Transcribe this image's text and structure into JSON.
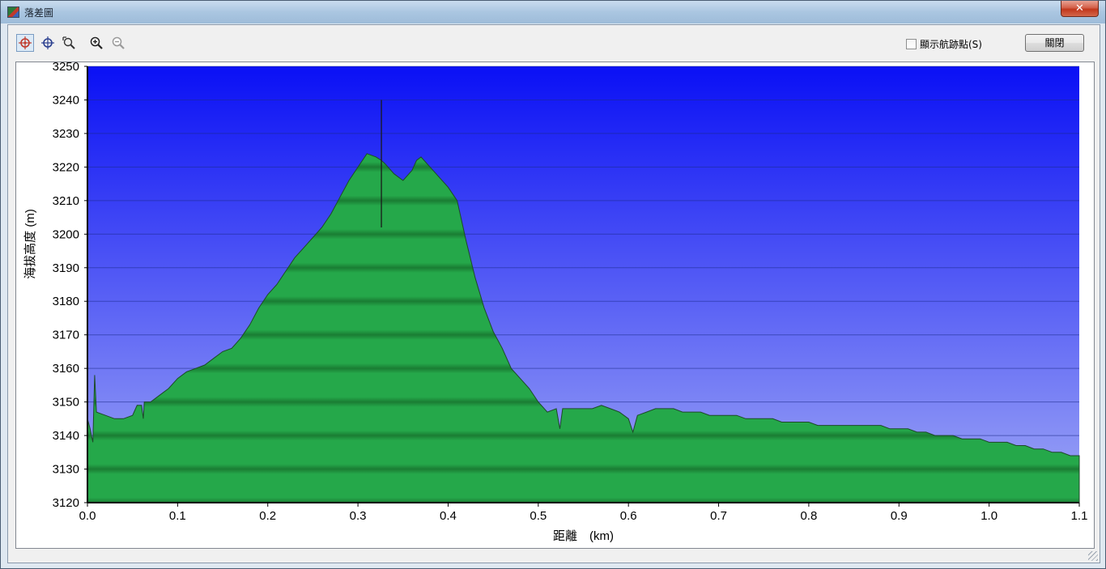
{
  "window": {
    "title": "落差圖",
    "close_glyph": "✕"
  },
  "toolbar": {
    "tools": [
      {
        "icon": "crosshair-select-icon",
        "active": true
      },
      {
        "icon": "crosshair-icon",
        "active": false
      },
      {
        "icon": "zoom-area-icon",
        "active": false
      },
      {
        "icon": "zoom-in-icon",
        "active": false
      },
      {
        "icon": "zoom-out-icon",
        "active": false
      }
    ],
    "show_waypoints_label": "顯示航跡點(S)",
    "show_waypoints_checked": false,
    "close_button_label": "關閉"
  },
  "colors": {
    "sky_top": "#0a10f5",
    "sky_bottom": "#9ea7f5",
    "terrain_light": "#25a84a",
    "terrain_dark": "#1a7d33",
    "terrain_outline": "#1d4a28",
    "axis": "#000000"
  },
  "chart_data": {
    "type": "area",
    "xlabel": "距離　(km)",
    "ylabel": "海拔高度 (m)",
    "xlim": [
      0.0,
      1.1
    ],
    "ylim": [
      3120,
      3250
    ],
    "xticks": [
      "0.0",
      "0.1",
      "0.2",
      "0.3",
      "0.4",
      "0.5",
      "0.6",
      "0.7",
      "0.8",
      "0.9",
      "1.0",
      "1.1"
    ],
    "yticks": [
      "3120",
      "3130",
      "3140",
      "3150",
      "3160",
      "3170",
      "3180",
      "3190",
      "3200",
      "3210",
      "3220",
      "3230",
      "3240",
      "3250"
    ],
    "grid": true,
    "cursor_x": 0.326,
    "series": [
      {
        "x": [
          0.0,
          0.003,
          0.006,
          0.008,
          0.01,
          0.02,
          0.03,
          0.04,
          0.05,
          0.055,
          0.06,
          0.062,
          0.063,
          0.07,
          0.08,
          0.09,
          0.1,
          0.11,
          0.12,
          0.13,
          0.14,
          0.15,
          0.16,
          0.17,
          0.18,
          0.19,
          0.2,
          0.21,
          0.22,
          0.23,
          0.24,
          0.25,
          0.26,
          0.27,
          0.28,
          0.29,
          0.3,
          0.31,
          0.32,
          0.326,
          0.33,
          0.34,
          0.35,
          0.36,
          0.365,
          0.37,
          0.38,
          0.39,
          0.4,
          0.41,
          0.42,
          0.43,
          0.44,
          0.45,
          0.46,
          0.47,
          0.48,
          0.49,
          0.5,
          0.51,
          0.52,
          0.524,
          0.527,
          0.53,
          0.54,
          0.55,
          0.56,
          0.57,
          0.58,
          0.59,
          0.6,
          0.605,
          0.61,
          0.62,
          0.63,
          0.64,
          0.65,
          0.66,
          0.67,
          0.68,
          0.69,
          0.7,
          0.71,
          0.72,
          0.73,
          0.74,
          0.75,
          0.76,
          0.77,
          0.78,
          0.79,
          0.8,
          0.81,
          0.82,
          0.83,
          0.84,
          0.85,
          0.86,
          0.87,
          0.88,
          0.89,
          0.9,
          0.91,
          0.92,
          0.93,
          0.94,
          0.95,
          0.96,
          0.97,
          0.98,
          0.99,
          1.0,
          1.01,
          1.02,
          1.03,
          1.04,
          1.05,
          1.06,
          1.07,
          1.08,
          1.09,
          1.1
        ],
        "y": [
          3145,
          3142,
          3138,
          3158,
          3147,
          3146,
          3145,
          3145,
          3146,
          3149,
          3149,
          3145,
          3150,
          3150,
          3152,
          3154,
          3157,
          3159,
          3160,
          3161,
          3163,
          3165,
          3166,
          3169,
          3173,
          3178,
          3182,
          3185,
          3189,
          3193,
          3196,
          3199,
          3202,
          3206,
          3211,
          3216,
          3220,
          3224,
          3223,
          3222,
          3221,
          3218,
          3216,
          3219,
          3222,
          3223,
          3220,
          3217,
          3214,
          3210,
          3198,
          3187,
          3178,
          3171,
          3166,
          3160,
          3157,
          3154,
          3150,
          3147,
          3148,
          3142,
          3148,
          3148,
          3148,
          3148,
          3148,
          3149,
          3148,
          3147,
          3145,
          3141,
          3146,
          3147,
          3148,
          3148,
          3148,
          3147,
          3147,
          3147,
          3146,
          3146,
          3146,
          3146,
          3145,
          3145,
          3145,
          3145,
          3144,
          3144,
          3144,
          3144,
          3143,
          3143,
          3143,
          3143,
          3143,
          3143,
          3143,
          3143,
          3142,
          3142,
          3142,
          3141,
          3141,
          3140,
          3140,
          3140,
          3139,
          3139,
          3139,
          3138,
          3138,
          3138,
          3137,
          3137,
          3136,
          3136,
          3135,
          3135,
          3134,
          3134
        ]
      }
    ]
  }
}
